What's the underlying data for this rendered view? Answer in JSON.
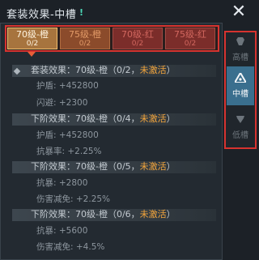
{
  "header": {
    "title": "套装效果-中槽",
    "help_icon": "!",
    "close_icon": "✕"
  },
  "tabs": [
    {
      "name": "70级-橙",
      "count": "0/2"
    },
    {
      "name": "75级-橙",
      "count": "0/2"
    },
    {
      "name": "70级-红",
      "count": "0/2"
    },
    {
      "name": "75级-红",
      "count": "0/2"
    }
  ],
  "sections": [
    {
      "prefix": "套装效果：70级-橙（0/2，",
      "status": "未激活",
      "suffix": "）",
      "stats": [
        "护盾: +452800",
        "闪避: +2300"
      ]
    },
    {
      "prefix": "下阶效果：70级-橙（0/4，",
      "status": "未激活",
      "suffix": "）",
      "stats": [
        "护盾: +452800",
        "抗暴率: +2.25%"
      ]
    },
    {
      "prefix": "下阶效果：70级-橙（0/5，",
      "status": "未激活",
      "suffix": "）",
      "stats": [
        "抗暴: +2800",
        "伤害减免: +2.25%"
      ]
    },
    {
      "prefix": "下阶效果：70级-橙（0/6，",
      "status": "未激活",
      "suffix": "）",
      "stats": [
        "抗暴: +5600",
        "伤害减免: +4.5%"
      ]
    }
  ],
  "side_tabs": [
    {
      "label": "高槽",
      "icon": "high-slot-icon"
    },
    {
      "label": "中槽",
      "icon": "mid-slot-icon"
    },
    {
      "label": "低槽",
      "icon": "low-slot-icon"
    }
  ],
  "colors": {
    "accent_red": "#d7332f",
    "active_orange": "#f3a53c",
    "selected_blue": "#3a6f8e",
    "teal": "#4cd9b8"
  }
}
